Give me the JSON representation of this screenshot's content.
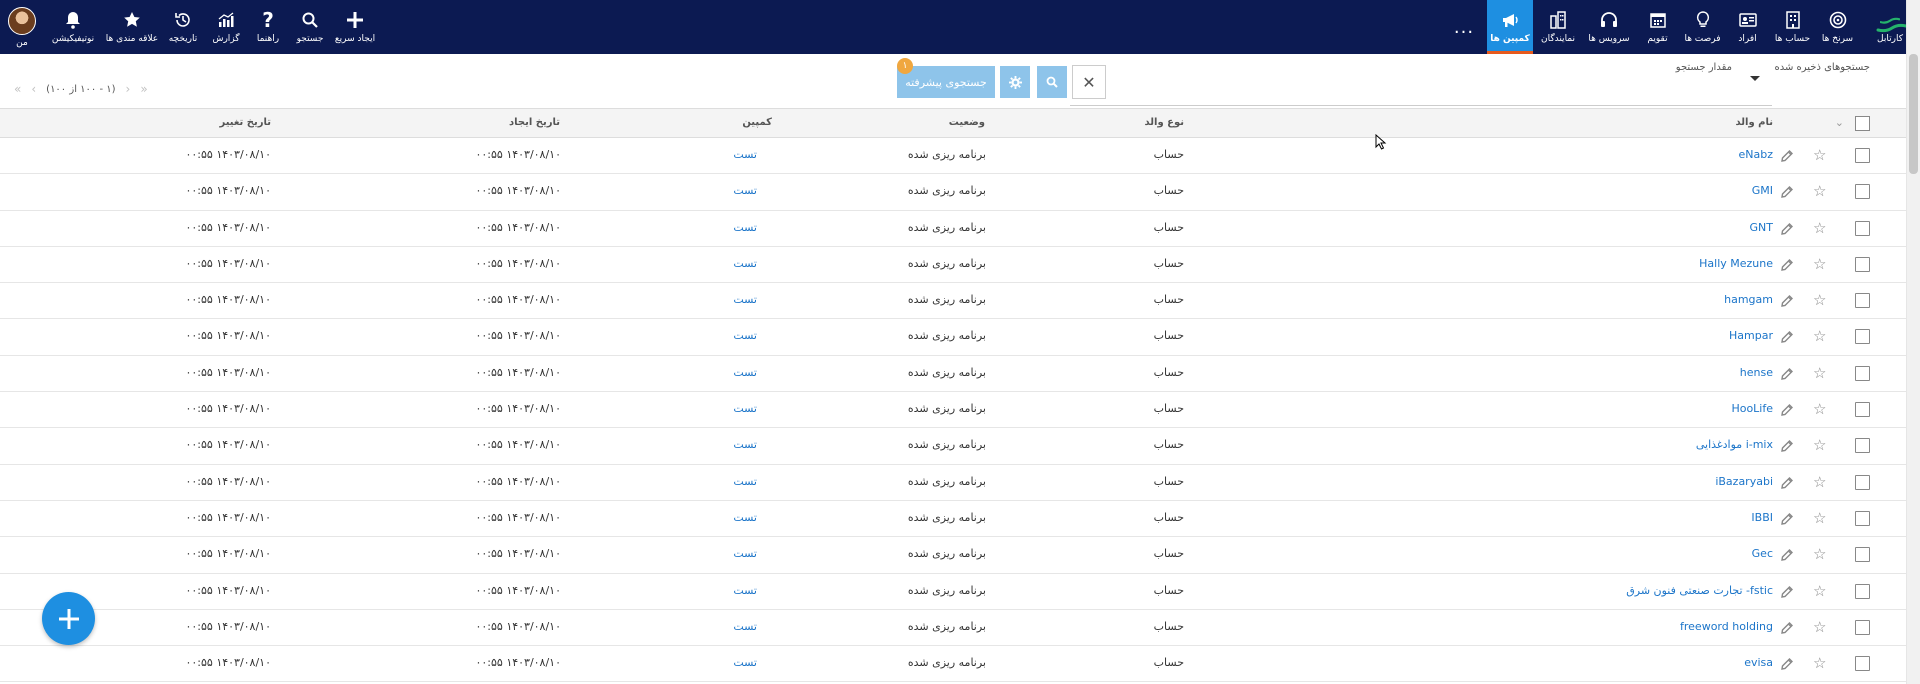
{
  "nav": {
    "items": [
      {
        "label": "کارتابل",
        "icon": "dashboard-logo"
      },
      {
        "label": "سرنخ ها",
        "icon": "target-icon"
      },
      {
        "label": "حساب ها",
        "icon": "building-icon"
      },
      {
        "label": "افراد",
        "icon": "contact-card-icon"
      },
      {
        "label": "فرصت ها",
        "icon": "lightbulb-icon"
      },
      {
        "label": "تقویم",
        "icon": "calendar-icon"
      },
      {
        "label": "سرویس ها",
        "icon": "headset-icon"
      },
      {
        "label": "نمایندگان",
        "icon": "agents-icon"
      },
      {
        "label": "کمپین ها",
        "icon": "megaphone-icon",
        "active": true
      }
    ],
    "more_label": "...",
    "left_items": [
      {
        "label": "من",
        "icon": "avatar"
      },
      {
        "label": "نوتیفیکیشن",
        "icon": "bell-icon"
      },
      {
        "label": "علاقه مندی ها",
        "icon": "star-icon"
      },
      {
        "label": "تاریخچه",
        "icon": "history-icon"
      },
      {
        "label": "گزارش",
        "icon": "chart-icon"
      },
      {
        "label": "راهنما",
        "icon": "help-icon"
      },
      {
        "label": "جستجو",
        "icon": "search-icon"
      },
      {
        "label": "ایجاد سریع",
        "icon": "plus-icon"
      }
    ]
  },
  "search": {
    "saved_searches_label": "جستجوهای ذخیره شده",
    "search_value_label": "مقدار جستجو",
    "advanced_label": "جستجوی پیشرفته",
    "badge_count": "۱",
    "clear_symbol": "✕"
  },
  "pager": {
    "text": "(۱ - ۱۰۰ از ۱۰۰)"
  },
  "table": {
    "headers": {
      "parent_name": "نام والد",
      "parent_type": "نوع والد",
      "status": "وضعیت",
      "campaign": "کمپین",
      "created": "تاریخ ایجاد",
      "modified": "تاریخ تغییر"
    },
    "rows": [
      {
        "name": "eNabz",
        "type": "حساب",
        "status": "برنامه ریزی شده",
        "campaign": "تست",
        "created": "۱۴۰۳/۰۸/۱۰ ۰۰:۵۵",
        "modified": "۱۴۰۳/۰۸/۱۰ ۰۰:۵۵"
      },
      {
        "name": "GMI",
        "type": "حساب",
        "status": "برنامه ریزی شده",
        "campaign": "تست",
        "created": "۱۴۰۳/۰۸/۱۰ ۰۰:۵۵",
        "modified": "۱۴۰۳/۰۸/۱۰ ۰۰:۵۵"
      },
      {
        "name": "GNT",
        "type": "حساب",
        "status": "برنامه ریزی شده",
        "campaign": "تست",
        "created": "۱۴۰۳/۰۸/۱۰ ۰۰:۵۵",
        "modified": "۱۴۰۳/۰۸/۱۰ ۰۰:۵۵"
      },
      {
        "name": "Hally Mezune",
        "type": "حساب",
        "status": "برنامه ریزی شده",
        "campaign": "تست",
        "created": "۱۴۰۳/۰۸/۱۰ ۰۰:۵۵",
        "modified": "۱۴۰۳/۰۸/۱۰ ۰۰:۵۵"
      },
      {
        "name": "hamgam",
        "type": "حساب",
        "status": "برنامه ریزی شده",
        "campaign": "تست",
        "created": "۱۴۰۳/۰۸/۱۰ ۰۰:۵۵",
        "modified": "۱۴۰۳/۰۸/۱۰ ۰۰:۵۵"
      },
      {
        "name": "Hampar",
        "type": "حساب",
        "status": "برنامه ریزی شده",
        "campaign": "تست",
        "created": "۱۴۰۳/۰۸/۱۰ ۰۰:۵۵",
        "modified": "۱۴۰۳/۰۸/۱۰ ۰۰:۵۵"
      },
      {
        "name": "hense",
        "type": "حساب",
        "status": "برنامه ریزی شده",
        "campaign": "تست",
        "created": "۱۴۰۳/۰۸/۱۰ ۰۰:۵۵",
        "modified": "۱۴۰۳/۰۸/۱۰ ۰۰:۵۵"
      },
      {
        "name": "HooLife",
        "type": "حساب",
        "status": "برنامه ریزی شده",
        "campaign": "تست",
        "created": "۱۴۰۳/۰۸/۱۰ ۰۰:۵۵",
        "modified": "۱۴۰۳/۰۸/۱۰ ۰۰:۵۵"
      },
      {
        "name": "i-mix مواد‌غذایی",
        "type": "حساب",
        "status": "برنامه ریزی شده",
        "campaign": "تست",
        "created": "۱۴۰۳/۰۸/۱۰ ۰۰:۵۵",
        "modified": "۱۴۰۳/۰۸/۱۰ ۰۰:۵۵"
      },
      {
        "name": "iBazaryabi",
        "type": "حساب",
        "status": "برنامه ریزی شده",
        "campaign": "تست",
        "created": "۱۴۰۳/۰۸/۱۰ ۰۰:۵۵",
        "modified": "۱۴۰۳/۰۸/۱۰ ۰۰:۵۵"
      },
      {
        "name": "IBBI",
        "type": "حساب",
        "status": "برنامه ریزی شده",
        "campaign": "تست",
        "created": "۱۴۰۳/۰۸/۱۰ ۰۰:۵۵",
        "modified": "۱۴۰۳/۰۸/۱۰ ۰۰:۵۵"
      },
      {
        "name": "Gec",
        "type": "حساب",
        "status": "برنامه ریزی شده",
        "campaign": "تست",
        "created": "۱۴۰۳/۰۸/۱۰ ۰۰:۵۵",
        "modified": "۱۴۰۳/۰۸/۱۰ ۰۰:۵۵"
      },
      {
        "name": "fstic- تجارت صنعتی فنون شرق",
        "type": "حساب",
        "status": "برنامه ریزی شده",
        "campaign": "تست",
        "created": "۱۴۰۳/۰۸/۱۰ ۰۰:۵۵",
        "modified": "۱۴۰۳/۰۸/۱۰ ۰۰:۵۵"
      },
      {
        "name": "freeword holding",
        "type": "حساب",
        "status": "برنامه ریزی شده",
        "campaign": "تست",
        "created": "۱۴۰۳/۰۸/۱۰ ۰۰:۵۵",
        "modified": "۱۴۰۳/۰۸/۱۰ ۰۰:۵۵"
      },
      {
        "name": "evisa",
        "type": "حساب",
        "status": "برنامه ریزی شده",
        "campaign": "تست",
        "created": "۱۴۰۳/۰۸/۱۰ ۰۰:۵۵",
        "modified": "۱۴۰۳/۰۸/۱۰ ۰۰:۵۵"
      }
    ]
  },
  "colors": {
    "nav_bg": "#0c1a52",
    "active_tab": "#1e8fe1",
    "active_underline": "#e75a1d",
    "link": "#1c75c9",
    "button_light": "#8ec4ea"
  }
}
